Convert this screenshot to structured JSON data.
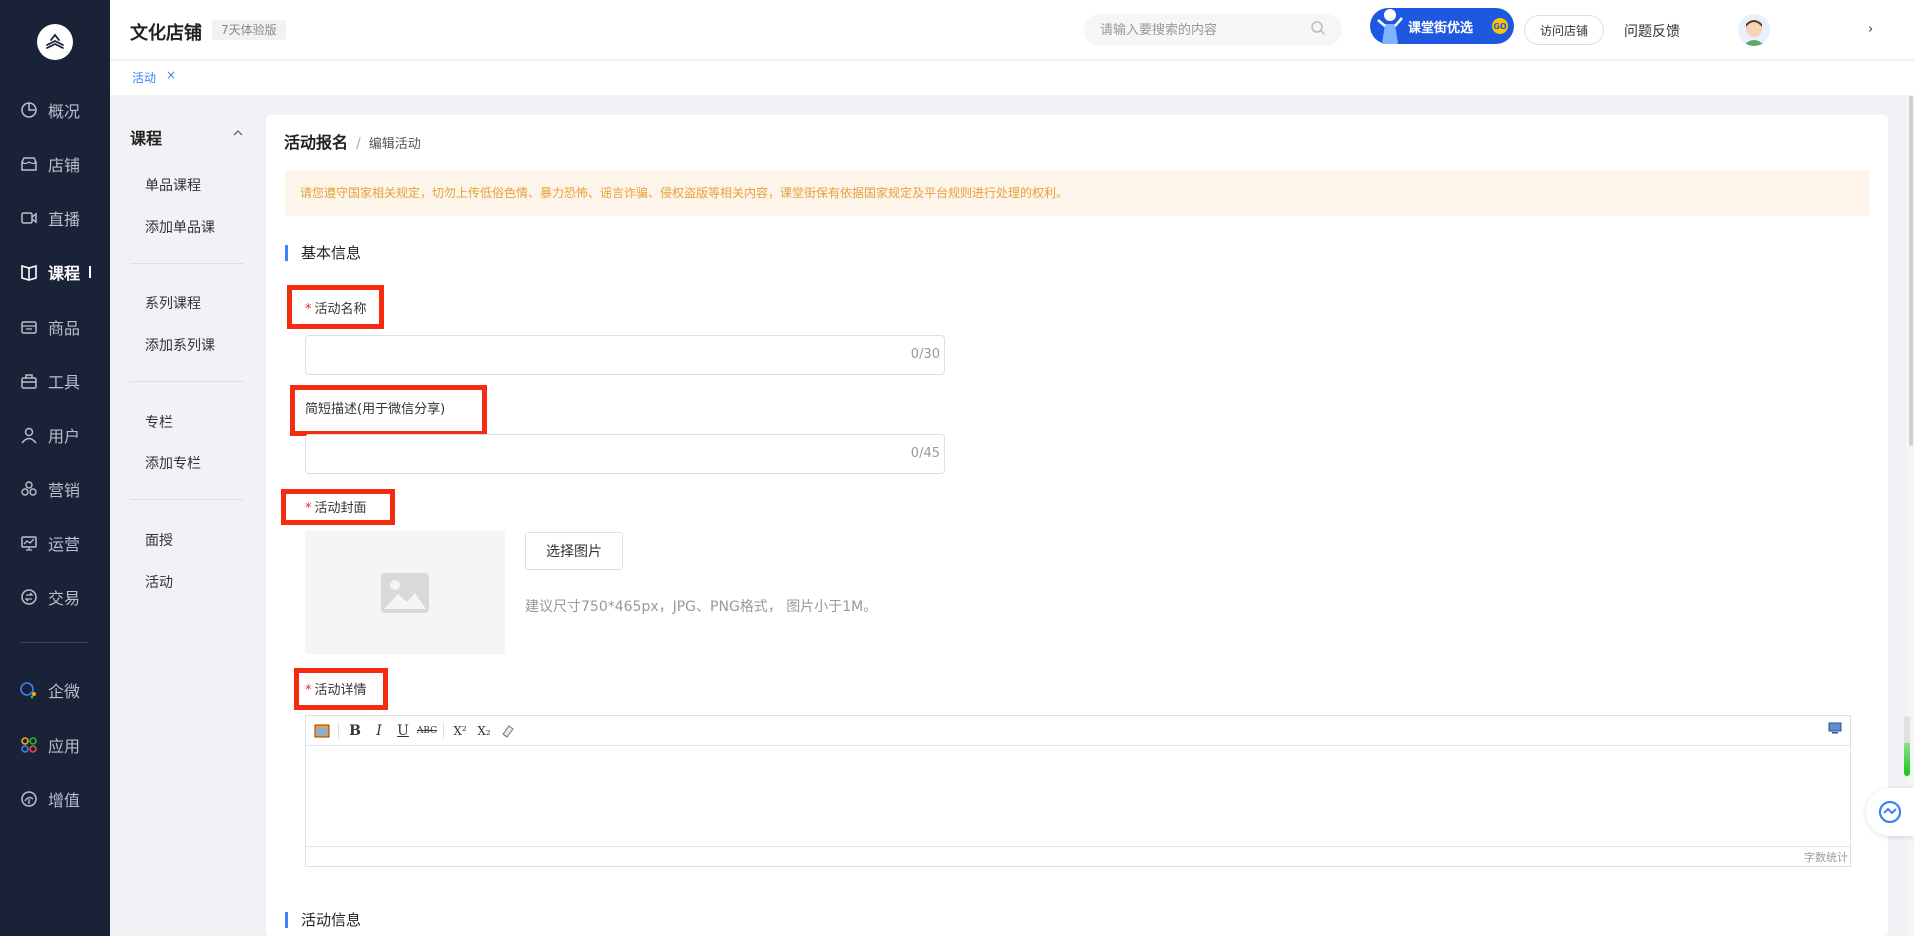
{
  "sidebar": {
    "items": [
      {
        "label": "概况",
        "icon": "overview-icon"
      },
      {
        "label": "店铺",
        "icon": "store-icon"
      },
      {
        "label": "直播",
        "icon": "live-icon"
      },
      {
        "label": "课程",
        "icon": "course-icon",
        "active": true
      },
      {
        "label": "商品",
        "icon": "goods-icon"
      },
      {
        "label": "工具",
        "icon": "toolbox-icon"
      },
      {
        "label": "用户",
        "icon": "user-icon"
      },
      {
        "label": "营销",
        "icon": "marketing-icon"
      },
      {
        "label": "运营",
        "icon": "operations-icon"
      },
      {
        "label": "交易",
        "icon": "trade-icon"
      },
      {
        "label": "企微",
        "icon": "wecom-icon"
      },
      {
        "label": "应用",
        "icon": "apps-icon"
      },
      {
        "label": "增值",
        "icon": "value-added-icon"
      }
    ]
  },
  "header": {
    "shop_name": "文化店铺",
    "trial_badge": "7天体验版",
    "search_placeholder": "请输入要搜索的内容",
    "promo_label": "课堂街优选",
    "promo_go": "GO",
    "visit_store": "访问店铺",
    "feedback": "问题反馈",
    "caret": "›"
  },
  "tags": {
    "active": "活动",
    "close": "×"
  },
  "subnav": {
    "title": "课程",
    "groups": [
      [
        "单品课程",
        "添加单品课"
      ],
      [
        "系列课程",
        "添加系列课"
      ],
      [
        "专栏",
        "添加专栏"
      ],
      [
        "面授",
        "活动"
      ]
    ]
  },
  "breadcrumb": {
    "parent": "活动报名",
    "sep": "/",
    "current": "编辑活动"
  },
  "notice": "请您遵守国家相关规定，切勿上传低俗色情、暴力恐怖、谣言诈骗、侵权盗版等相关内容，课堂街保有依据国家规定及平台规则进行处理的权利。",
  "sections": {
    "basic": "基本信息",
    "activity": "活动信息"
  },
  "form": {
    "required_mark": "*",
    "name_label": "活动名称",
    "name_value": "",
    "name_count": "0/30",
    "desc_label": "简短描述(用于微信分享)",
    "desc_value": "",
    "desc_count": "0/45",
    "cover_label": "活动封面",
    "pick_image": "选择图片",
    "cover_hint": "建议尺寸750*465px，JPG、PNG格式， 图片小于1M。",
    "detail_label": "活动详情",
    "word_count": "字数统计"
  },
  "editor_toolbar": {
    "bold": "B",
    "italic": "I",
    "underline": "U",
    "strike": "ABC",
    "superscript": "X²",
    "subscript": "X₂"
  },
  "scroll_progress": 0.55,
  "colors": {
    "sidebar_bg": "#1a2238",
    "accent": "#3b82f6",
    "warning_text": "#e6a23c",
    "highlight_box": "#f52a0f"
  }
}
